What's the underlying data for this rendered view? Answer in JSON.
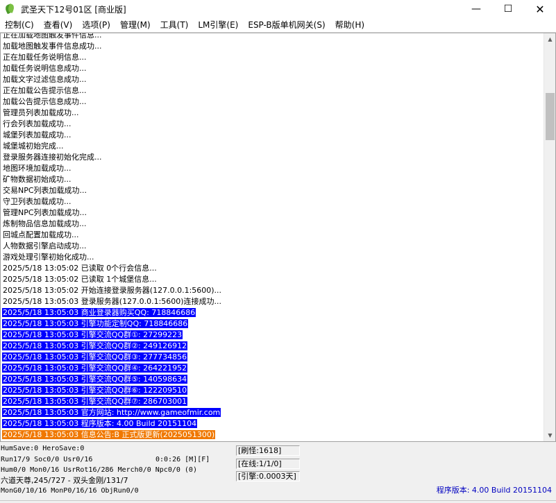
{
  "window": {
    "title": "武圣天下12号01区 [商业版]",
    "minimize_glyph": "—",
    "maximize_glyph": "☐",
    "close_glyph": "✕"
  },
  "menu": [
    {
      "id": "control",
      "label": "控制(C)"
    },
    {
      "id": "view",
      "label": "查看(V)"
    },
    {
      "id": "options",
      "label": "选项(P)"
    },
    {
      "id": "manage",
      "label": "管理(M)"
    },
    {
      "id": "tools",
      "label": "工具(T)"
    },
    {
      "id": "lm-engine",
      "label": "LM引擎(E)"
    },
    {
      "id": "esp-gateway",
      "label": "ESP-B版单机网关(S)"
    },
    {
      "id": "help",
      "label": "帮助(H)"
    }
  ],
  "log": [
    {
      "text": "正在加载地图触发事件信息...",
      "style": "normal"
    },
    {
      "text": "加载地图触发事件信息成功...",
      "style": "normal"
    },
    {
      "text": "正在加载任务说明信息...",
      "style": "normal"
    },
    {
      "text": "加载任务说明信息成功...",
      "style": "normal"
    },
    {
      "text": "加载文字过滤信息成功...",
      "style": "normal"
    },
    {
      "text": "正在加载公告提示信息...",
      "style": "normal"
    },
    {
      "text": "加载公告提示信息成功...",
      "style": "normal"
    },
    {
      "text": "管理员列表加载成功...",
      "style": "normal"
    },
    {
      "text": "行会列表加载成功...",
      "style": "normal"
    },
    {
      "text": "城堡列表加载成功...",
      "style": "normal"
    },
    {
      "text": "城堡城初始完成...",
      "style": "normal"
    },
    {
      "text": "登录服务器连接初始化完成...",
      "style": "normal"
    },
    {
      "text": "地图环境加载成功...",
      "style": "normal"
    },
    {
      "text": "矿物数据初始成功...",
      "style": "normal"
    },
    {
      "text": "交易NPC列表加载成功...",
      "style": "normal"
    },
    {
      "text": "守卫列表加载成功...",
      "style": "normal"
    },
    {
      "text": "管理NPC列表加载成功...",
      "style": "normal"
    },
    {
      "text": "炼制物品信息加载成功...",
      "style": "normal"
    },
    {
      "text": "回城点配置加载成功...",
      "style": "normal"
    },
    {
      "text": "人物数据引擎启动成功...",
      "style": "normal"
    },
    {
      "text": "游戏处理引擎初始化成功...",
      "style": "normal"
    },
    {
      "text": "2025/5/18 13:05:02 已读取 0个行会信息...",
      "style": "normal"
    },
    {
      "text": "2025/5/18 13:05:02 已读取 1个城堡信息...",
      "style": "normal"
    },
    {
      "text": "2025/5/18 13:05:02 开始连接登录服务器(127.0.0.1:5600)...",
      "style": "normal"
    },
    {
      "text": "2025/5/18 13:05:03 登录服务器(127.0.0.1:5600)连接成功...",
      "style": "normal"
    },
    {
      "text": "2025/5/18 13:05:03 商业登录器购买QQ: 718846686",
      "style": "blue"
    },
    {
      "text": "2025/5/18 13:05:03 引擎功能定制QQ: 718846686",
      "style": "blue"
    },
    {
      "text": "2025/5/18 13:05:03 引擎交流QQ群①: 27299223",
      "style": "blue"
    },
    {
      "text": "2025/5/18 13:05:03 引擎交流QQ群②: 249126912",
      "style": "blue"
    },
    {
      "text": "2025/5/18 13:05:03 引擎交流QQ群③: 277734856",
      "style": "blue"
    },
    {
      "text": "2025/5/18 13:05:03 引擎交流QQ群④: 264221952",
      "style": "blue"
    },
    {
      "text": "2025/5/18 13:05:03 引擎交流QQ群⑤: 140598634",
      "style": "blue"
    },
    {
      "text": "2025/5/18 13:05:03 引擎交流QQ群⑥: 122209510",
      "style": "blue"
    },
    {
      "text": "2025/5/18 13:05:03 引擎交流QQ群⑦: 286703001",
      "style": "blue"
    },
    {
      "text": "2025/5/18 13:05:03 官方网站: http://www.gameofmir.com",
      "style": "blue"
    },
    {
      "text": "2025/5/18 13:05:03 程序版本: 4.00 Build 20151104",
      "style": "blue"
    },
    {
      "text": "2025/5/18 13:05:03 信息公告:B 正式版更新(2025051300)",
      "style": "orange"
    }
  ],
  "status": {
    "line1": "HumSave:0 HeroSave:0",
    "line2": "Run17/9 Soc0/0 Usr0/16",
    "runtime": "0:0:26 [M][F]",
    "line3": "Hum0/0 Mon0/16 UsrRot16/286 Merch0/0 Npc0/0 (0)",
    "line4": "六道天尊,245/727 - 双头金刚/131/7",
    "line5": "MonG0/10/16 MonP0/16/16 ObjRun0/0",
    "refresh_monsters": "[刷怪:1618]",
    "online": "[在线:1/1/0]",
    "engine": "[引擎:0.0003天]",
    "version": "程序版本: 4.00 Build 20151104"
  }
}
